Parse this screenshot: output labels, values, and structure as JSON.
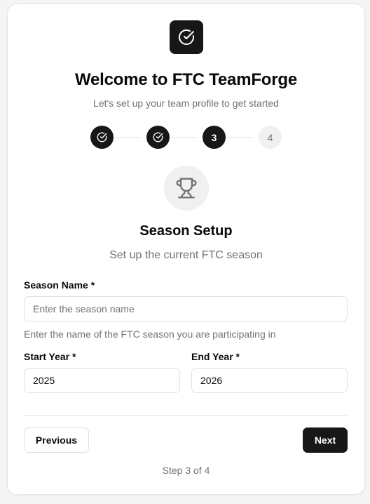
{
  "header": {
    "logo_icon": "check-circle-icon",
    "title": "Welcome to FTC TeamForge",
    "subtitle": "Let's set up your team profile to get started"
  },
  "stepper": {
    "steps": [
      {
        "status": "done",
        "label": "",
        "icon": "check-circle-icon"
      },
      {
        "status": "done",
        "label": "",
        "icon": "check-circle-icon"
      },
      {
        "status": "current",
        "label": "3"
      },
      {
        "status": "pending",
        "label": "4"
      }
    ]
  },
  "section": {
    "icon": "trophy-icon",
    "title": "Season Setup",
    "subtitle": "Set up the current FTC season"
  },
  "form": {
    "season_name": {
      "label": "Season Name *",
      "value": "",
      "placeholder": "Enter the season name",
      "hint": "Enter the name of the FTC season you are participating in"
    },
    "start_year": {
      "label": "Start Year *",
      "value": "2025"
    },
    "end_year": {
      "label": "End Year *",
      "value": "2026"
    }
  },
  "actions": {
    "previous_label": "Previous",
    "next_label": "Next"
  },
  "footer": {
    "step_text": "Step 3 of 4"
  },
  "colors": {
    "primary": "#171717",
    "muted_text": "#737373",
    "border": "#e5e5e5",
    "muted_bg": "#f0f0f0"
  }
}
